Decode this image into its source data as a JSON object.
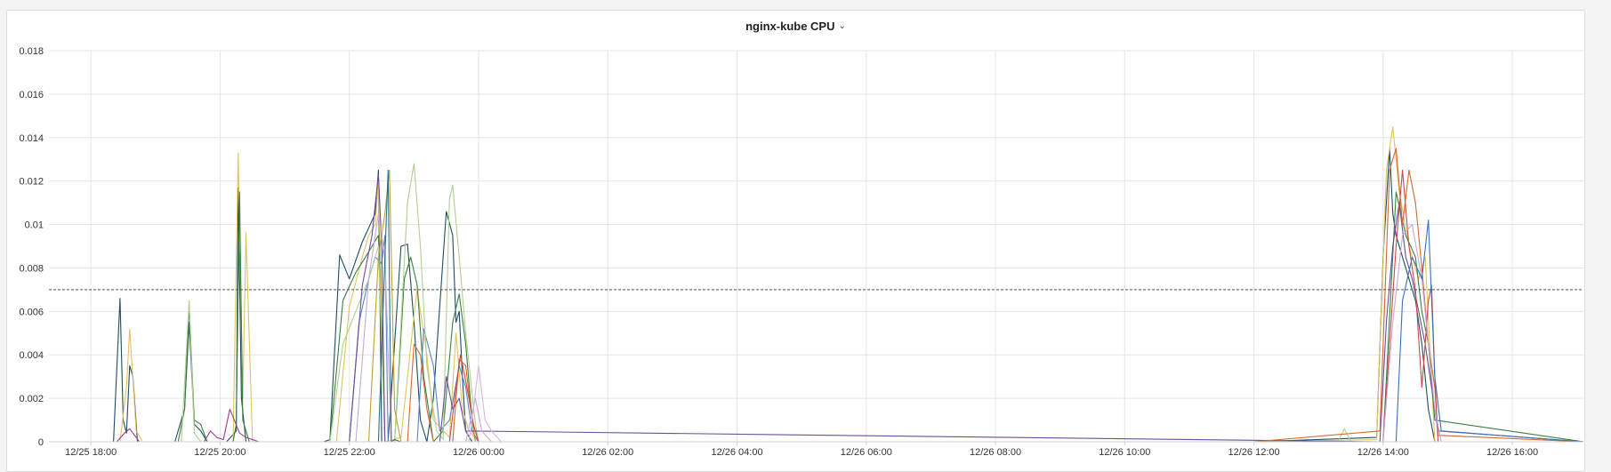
{
  "panel": {
    "title": "nginx-kube CPU",
    "chevron_icon": "chevron-down-icon"
  },
  "chart_data": {
    "type": "line",
    "title": "nginx-kube CPU",
    "xlabel": "",
    "ylabel": "",
    "grid": true,
    "legend": "none",
    "y_unit": "cores",
    "ylim": [
      0,
      0.018
    ],
    "yticks": [
      0,
      0.002,
      0.004,
      0.006,
      0.008,
      0.01,
      0.012,
      0.014,
      0.016,
      0.018
    ],
    "ytick_labels": [
      "0",
      "0.002",
      "0.004",
      "0.006",
      "0.008",
      "0.01",
      "0.012",
      "0.014",
      "0.016",
      "0.018"
    ],
    "x_unit": "hours since 12/25 00:00",
    "xlim": [
      17.35,
      41.1
    ],
    "xticks": [
      18,
      20,
      22,
      24,
      26,
      28,
      30,
      32,
      34,
      36,
      38,
      40
    ],
    "xtick_labels": [
      "12/25 18:00",
      "12/25 20:00",
      "12/25 22:00",
      "12/26 00:00",
      "12/26 02:00",
      "12/26 04:00",
      "12/26 06:00",
      "12/26 08:00",
      "12/26 10:00",
      "12/26 12:00",
      "12/26 14:00",
      "12/26 16:00"
    ],
    "threshold": {
      "value": 0.007,
      "style": "dashed",
      "color": "#555555"
    },
    "series": [
      {
        "color": "#1f4e5f",
        "x": [
          17.35,
          18.35,
          18.45,
          18.5,
          18.55,
          18.6,
          18.65,
          18.72,
          18.8,
          19.3,
          19.45,
          19.52,
          19.6,
          19.7,
          19.8,
          19.95,
          20.1,
          20.25,
          20.28,
          20.33,
          20.4,
          21.6,
          21.7,
          21.85,
          22.0,
          22.2,
          22.4,
          22.45,
          22.5,
          22.55,
          22.6,
          22.8,
          22.9,
          23.0,
          23.1,
          23.2,
          23.3,
          23.5,
          23.6,
          23.65,
          23.7,
          23.75,
          23.8,
          23.9,
          24.0,
          24.1,
          24.3,
          36.0,
          37.9,
          38.0,
          38.1,
          38.15,
          38.2,
          38.3,
          38.5,
          38.6,
          38.7,
          38.8,
          38.9,
          41.1
        ],
        "y": [
          0,
          0,
          0.0066,
          0.001,
          0.0004,
          0.0035,
          0.003,
          0.0,
          0,
          0,
          0.0015,
          0.0055,
          0.0008,
          0.0005,
          0.0,
          0,
          0,
          0.0005,
          0.0117,
          0.002,
          0.0,
          0,
          0.0001,
          0.0086,
          0.0075,
          0.0092,
          0.0105,
          0.0125,
          0.0,
          0,
          0.0,
          0.009,
          0.0091,
          0.0055,
          0.001,
          0.0,
          0.002,
          0.0106,
          0.0095,
          0.0055,
          0.006,
          0.003,
          0.0005,
          0.0,
          0,
          0,
          0,
          0,
          0.0002,
          0.0085,
          0.0135,
          0.0105,
          0.0095,
          0.0085,
          0.0065,
          0.0045,
          0.0015,
          0.0,
          0,
          0
        ]
      },
      {
        "color": "#e0c460",
        "x": [
          17.35,
          18.45,
          18.55,
          18.6,
          18.7,
          18.8,
          20.2,
          20.28,
          20.35,
          20.4,
          20.5,
          20.6,
          21.8,
          22.0,
          22.2,
          22.3,
          22.4,
          22.45,
          22.55,
          22.8,
          23.0,
          23.05,
          23.1,
          23.2,
          23.3,
          23.55,
          23.65,
          23.75,
          23.85,
          24.0,
          36.0,
          37.9,
          38.05,
          38.15,
          38.25,
          38.4,
          38.55,
          38.65,
          38.8,
          41.1
        ],
        "y": [
          0,
          0,
          0.0025,
          0.0052,
          0.0005,
          0,
          0,
          0.0133,
          0.002,
          0.0096,
          0.0,
          0,
          0.0,
          0.0062,
          0.0085,
          0.0095,
          0.01,
          0.012,
          0.0,
          0.0002,
          0.0058,
          0.007,
          0.006,
          0.004,
          0.001,
          0.0002,
          0.005,
          0.0015,
          0.0005,
          0,
          0,
          0.0001,
          0.0125,
          0.0145,
          0.0115,
          0.009,
          0.0075,
          0.0085,
          0.0,
          0
        ]
      },
      {
        "color": "#3a8040",
        "x": [
          17.35,
          19.35,
          19.45,
          19.52,
          19.6,
          19.7,
          19.8,
          20.2,
          20.25,
          20.3,
          20.35,
          20.45,
          20.6,
          21.7,
          21.9,
          22.1,
          22.25,
          22.35,
          22.45,
          22.55,
          22.7,
          22.85,
          22.95,
          23.05,
          23.15,
          23.3,
          23.45,
          23.6,
          23.7,
          23.8,
          23.9,
          24.0,
          36.0,
          38.0,
          38.2,
          38.35,
          38.5,
          38.6,
          38.7,
          38.8,
          41.1
        ],
        "y": [
          0,
          0,
          0.0015,
          0.0063,
          0.001,
          0.0008,
          0,
          0,
          0.0008,
          0.0115,
          0.001,
          0.0,
          0,
          0,
          0.0065,
          0.0078,
          0.0085,
          0.009,
          0.0095,
          0.0,
          0,
          0.0075,
          0.0085,
          0.0072,
          0.003,
          0.0,
          0.0005,
          0.0055,
          0.0068,
          0.0045,
          0.001,
          0,
          0,
          0.0,
          0.0115,
          0.0095,
          0.0085,
          0.006,
          0.0045,
          0.001,
          0
        ]
      },
      {
        "color": "#5a86c8",
        "x": [
          17.35,
          22.0,
          22.15,
          22.3,
          22.4,
          22.5,
          22.55,
          22.6,
          22.7,
          23.05,
          23.15,
          23.3,
          23.4,
          23.55,
          23.7,
          23.8,
          23.9,
          24.0,
          41.1
        ],
        "y": [
          0,
          0,
          0.0055,
          0.0075,
          0.0085,
          0.0082,
          0.0095,
          0.0,
          0,
          0,
          0.0052,
          0.0035,
          0.0005,
          0.001,
          0.0035,
          0.0025,
          0.0005,
          0,
          0
        ]
      },
      {
        "color": "#b0d090",
        "x": [
          17.35,
          19.4,
          19.52,
          19.6,
          19.7,
          21.7,
          21.9,
          22.1,
          22.3,
          22.45,
          22.55,
          22.7,
          22.9,
          23.0,
          23.1,
          23.2,
          23.35,
          23.45,
          23.55,
          23.6,
          23.7,
          23.8,
          23.95,
          24.0,
          37.3,
          37.4,
          37.5,
          41.1
        ],
        "y": [
          0,
          0,
          0.0065,
          0.0004,
          0,
          0,
          0.0045,
          0.006,
          0.0075,
          0.009,
          0.0,
          0,
          0.011,
          0.0128,
          0.009,
          0.0035,
          0.0005,
          0.0001,
          0.0112,
          0.0118,
          0.0085,
          0.005,
          0.0008,
          0,
          0,
          0.0006,
          0.0,
          0
        ]
      },
      {
        "color": "#6a4e9a",
        "x": [
          17.35,
          22.0,
          22.2,
          22.35,
          22.45,
          22.5,
          22.55,
          22.7,
          23.4,
          23.5,
          23.6,
          23.7,
          23.8,
          37.95,
          38.05,
          38.15,
          38.25,
          38.35,
          38.45,
          38.55,
          38.65,
          38.75,
          38.85,
          41.1
        ],
        "y": [
          0,
          0,
          0.0072,
          0.0095,
          0.0123,
          0.009,
          0.0,
          0,
          0,
          0.003,
          0.0015,
          0.002,
          0.0005,
          0,
          0.0055,
          0.009,
          0.011,
          0.0085,
          0.0075,
          0.006,
          0.0045,
          0.0025,
          0.0005,
          0
        ]
      },
      {
        "color": "#d06a30",
        "x": [
          17.35,
          22.9,
          23.0,
          23.1,
          23.2,
          23.3,
          23.6,
          23.7,
          23.8,
          23.9,
          23.95,
          36.0,
          37.95,
          38.1,
          38.2,
          38.3,
          38.4,
          38.5,
          38.6,
          38.7,
          38.8,
          38.85,
          41.1
        ],
        "y": [
          0,
          0,
          0.0045,
          0.004,
          0.0015,
          0,
          0,
          0.0038,
          0.0035,
          0.001,
          0,
          0,
          0.0005,
          0.0125,
          0.0135,
          0.01,
          0.0125,
          0.011,
          0.008,
          0.0045,
          0.0025,
          0.0003,
          0
        ]
      },
      {
        "color": "#c84a4a",
        "x": [
          17.35,
          23.55,
          23.65,
          23.72,
          23.8,
          23.85,
          23.92,
          24.0,
          36.0,
          38.0,
          38.1,
          38.2,
          38.3,
          38.4,
          38.5,
          38.6,
          38.7,
          38.75,
          38.8,
          38.85,
          41.1
        ],
        "y": [
          0,
          0,
          0.0025,
          0.004,
          0.0028,
          0.002,
          0.0008,
          0,
          0,
          0,
          0.0045,
          0.009,
          0.0125,
          0.009,
          0.007,
          0.0025,
          0.0065,
          0.0072,
          0.003,
          0.0,
          0
        ]
      },
      {
        "color": "#c8a8d8",
        "x": [
          17.35,
          22.1,
          22.3,
          22.45,
          22.55,
          22.65,
          23.8,
          23.95,
          24.05,
          24.2,
          38.0,
          38.15,
          38.3,
          38.45,
          38.6,
          38.7,
          38.8,
          38.9,
          41.1
        ],
        "y": [
          0,
          0,
          0.0075,
          0.0105,
          0.0085,
          0,
          0,
          0.002,
          0.0005,
          0,
          0,
          0.0055,
          0.0095,
          0.01,
          0.0075,
          0.0045,
          0.0015,
          0.0,
          0
        ]
      },
      {
        "color": "#d8b4e8",
        "x": [
          17.35,
          23.85,
          23.92,
          24.0,
          24.1,
          24.2,
          24.35,
          41.1
        ],
        "y": [
          0,
          0,
          0.0015,
          0.0035,
          0.001,
          0.0005,
          0,
          0
        ]
      },
      {
        "color": "#3a72b8",
        "x": [
          17.35,
          38.2,
          38.3,
          38.45,
          38.6,
          38.7,
          38.8,
          38.9,
          41.1
        ],
        "y": [
          0,
          0,
          0.0065,
          0.0085,
          0.0075,
          0.0102,
          0.003,
          0.0005,
          0
        ]
      },
      {
        "color": "#9a3a88",
        "x": [
          17.35,
          18.4,
          18.52,
          18.6,
          18.65,
          18.75,
          19.75,
          19.85,
          19.95,
          20.05,
          20.15,
          20.3,
          20.4,
          20.6,
          41.1
        ],
        "y": [
          0,
          0,
          0.0004,
          0.0006,
          0.0004,
          0,
          0,
          0.0005,
          0.0002,
          0.0001,
          0.0015,
          0.0004,
          0.0002,
          0,
          0
        ]
      },
      {
        "color": "#c0a030",
        "x": [
          17.35,
          22.3,
          22.45,
          22.55,
          22.62,
          22.7,
          22.8,
          41.1
        ],
        "y": [
          0,
          0,
          0.0085,
          0.0105,
          0.0125,
          0.0015,
          0.0,
          0
        ]
      },
      {
        "color": "#2e6c8a",
        "x": [
          17.35,
          22.45,
          22.55,
          22.6,
          22.65,
          22.7,
          22.8,
          41.1
        ],
        "y": [
          0,
          0,
          0.0085,
          0.0125,
          0.0,
          0.0001,
          0,
          0
        ]
      }
    ]
  },
  "colors": {
    "panel_bg": "#ffffff",
    "page_bg": "#f4f4f4",
    "grid": "#e6e6e6",
    "axis": "#cfcfcf",
    "threshold": "#555555"
  }
}
